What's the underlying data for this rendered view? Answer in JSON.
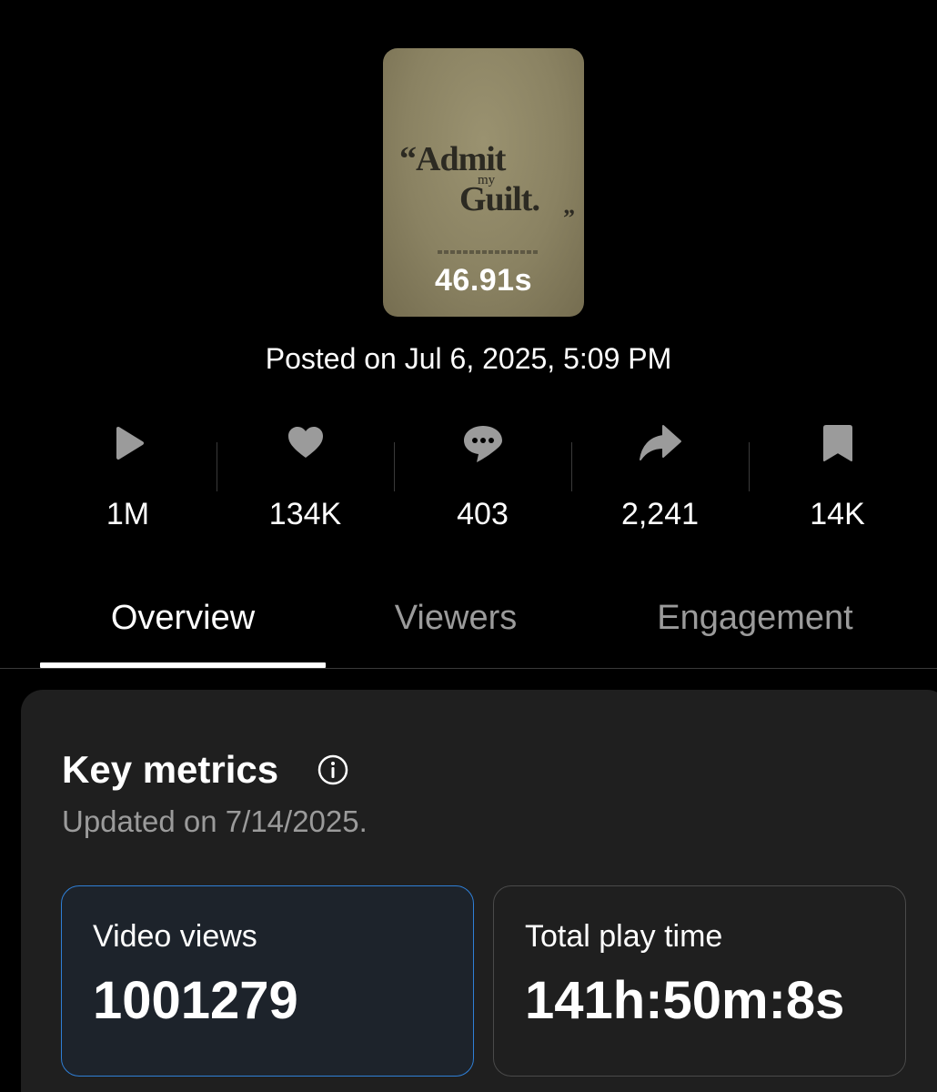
{
  "video": {
    "thumbnail_text": {
      "line1": "“Admit",
      "line2": "my",
      "line3": "Guilt.",
      "close_quote": "”"
    },
    "duration": "46.91s",
    "posted": "Posted on Jul 6, 2025, 5:09 PM"
  },
  "stats": [
    {
      "icon": "play-icon",
      "value": "1M"
    },
    {
      "icon": "heart-icon",
      "value": "134K"
    },
    {
      "icon": "comment-icon",
      "value": "403"
    },
    {
      "icon": "share-icon",
      "value": "2,241"
    },
    {
      "icon": "bookmark-icon",
      "value": "14K"
    }
  ],
  "tabs": [
    {
      "label": "Overview",
      "active": true
    },
    {
      "label": "Viewers",
      "active": false
    },
    {
      "label": "Engagement",
      "active": false
    }
  ],
  "key_metrics": {
    "title": "Key metrics",
    "info_icon": "info-icon",
    "updated": "Updated on 7/14/2025.",
    "metrics": [
      {
        "label": "Video views",
        "value": "1001279",
        "selected": true
      },
      {
        "label": "Total play time",
        "value": "141h:50m:8s",
        "selected": false
      }
    ]
  },
  "colors": {
    "background": "#000000",
    "card": "#1f1f1f",
    "icon_gray": "#9b9b9b",
    "selected_border": "#2f7fd6",
    "thumbnail": "#8a8262"
  }
}
